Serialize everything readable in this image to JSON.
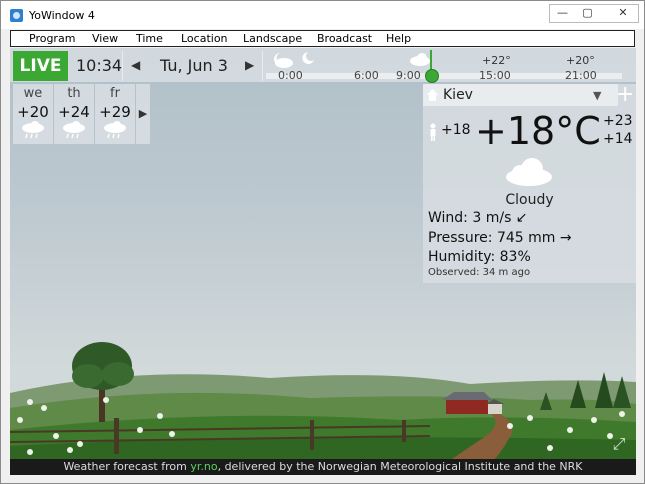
{
  "window": {
    "title": "YoWindow 4",
    "min": "—",
    "max": "▢",
    "close": "✕"
  },
  "menu": [
    "Program",
    "View",
    "Time",
    "Location",
    "Landscape",
    "Broadcast",
    "Help"
  ],
  "topbar": {
    "live": "LIVE",
    "time": "10:34",
    "date": "Tu, Jun 3",
    "prev": "◀",
    "next": "▶",
    "timeline": {
      "labels": [
        "0:00",
        "6:00",
        "9:00",
        "15:00",
        "21:00"
      ],
      "temps": [
        "+22°",
        "+20°"
      ]
    }
  },
  "forecast": [
    {
      "day": "we",
      "temp": "+20",
      "icon": "rain-cloud-icon"
    },
    {
      "day": "th",
      "temp": "+24",
      "icon": "rain-cloud-icon"
    },
    {
      "day": "fr",
      "temp": "+29",
      "icon": "rain-cloud-icon"
    }
  ],
  "forecast_more": "▶",
  "weather": {
    "city": "Kiev",
    "city_dropdown": "▼",
    "add": "+",
    "temp": "+18°C",
    "feels_like": "+18",
    "high": "+23",
    "low": "+14",
    "condition": "Cloudy",
    "wind": "Wind:  3 m/s ↙",
    "pressure": "Pressure:  745 mm →",
    "humidity": "Humidity:  83%",
    "observed": "Observed:  34 m ago"
  },
  "footer": {
    "prefix": "Weather forecast from ",
    "link": "yr.no",
    "suffix": ", delivered by the Norwegian Meteorological Institute and the NRK"
  },
  "colors": {
    "live": "#3ba833",
    "link": "#5cd15c",
    "footer_bg": "#1a1a1a"
  }
}
